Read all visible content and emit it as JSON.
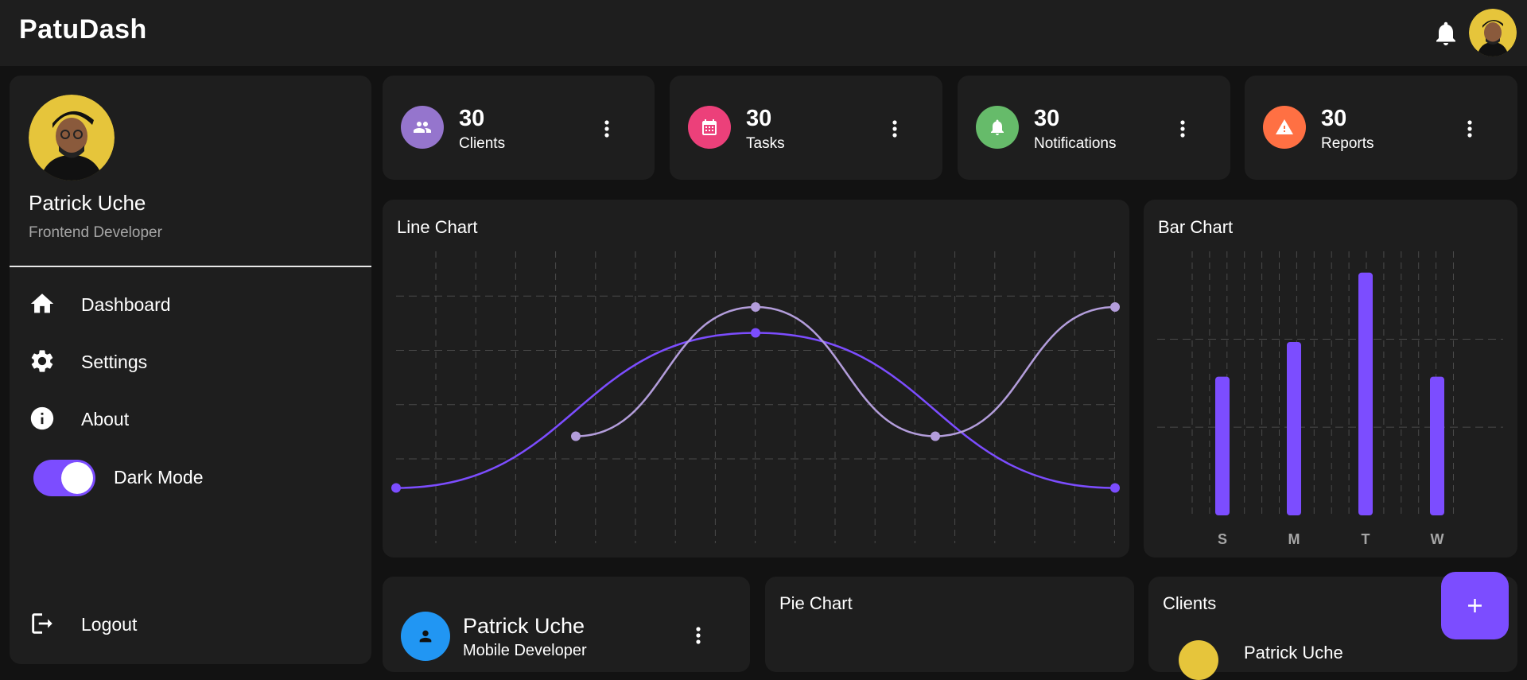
{
  "app": {
    "brand": "PatuDash"
  },
  "header": {
    "bell_icon": "bell-icon",
    "avatar": "user-avatar"
  },
  "sidebar": {
    "profile": {
      "name": "Patrick Uche",
      "role": "Frontend Developer"
    },
    "items": [
      {
        "label": "Dashboard",
        "icon": "home-icon"
      },
      {
        "label": "Settings",
        "icon": "gear-icon"
      },
      {
        "label": "About",
        "icon": "info-icon"
      }
    ],
    "dark_mode": {
      "label": "Dark Mode",
      "on": true
    },
    "logout": {
      "label": "Logout",
      "icon": "logout-icon"
    }
  },
  "stats": [
    {
      "value": "30",
      "label": "Clients",
      "icon": "people-icon",
      "color": "#9575cd"
    },
    {
      "value": "30",
      "label": "Tasks",
      "icon": "calendar-icon",
      "color": "#ec407a"
    },
    {
      "value": "30",
      "label": "Notifications",
      "icon": "bell-icon",
      "color": "#66bb6a"
    },
    {
      "value": "30",
      "label": "Reports",
      "icon": "warning-icon",
      "color": "#ff7043"
    }
  ],
  "line_card": {
    "title": "Line Chart"
  },
  "bar_card": {
    "title": "Bar Chart"
  },
  "chart_data": [
    {
      "type": "line",
      "x": [
        0,
        1,
        2,
        3,
        4
      ],
      "ylim": [
        0,
        10
      ],
      "series": [
        {
          "x": [
            0,
            2,
            4
          ],
          "values": [
            1,
            7,
            1
          ],
          "color": "#7c4dff",
          "shape": "spline"
        },
        {
          "x": [
            1,
            2,
            3,
            4
          ],
          "values": [
            3,
            8,
            3,
            8
          ],
          "color": "#b39ddb",
          "shape": "spline"
        }
      ],
      "grid": true
    },
    {
      "type": "bar",
      "categories": [
        "S",
        "M",
        "T",
        "W"
      ],
      "values": [
        4,
        5,
        7,
        4
      ],
      "ylim": [
        0,
        7.5
      ],
      "color": "#7c4dff",
      "grid": true
    }
  ],
  "person_card": {
    "name": "Patrick Uche",
    "role": "Mobile Developer",
    "icon": "person-icon",
    "color": "#2196f3"
  },
  "pie_card": {
    "title": "Pie Chart"
  },
  "clients_card": {
    "title": "Clients",
    "first_item": "Patrick Uche"
  },
  "fab": {
    "icon": "plus-icon"
  }
}
